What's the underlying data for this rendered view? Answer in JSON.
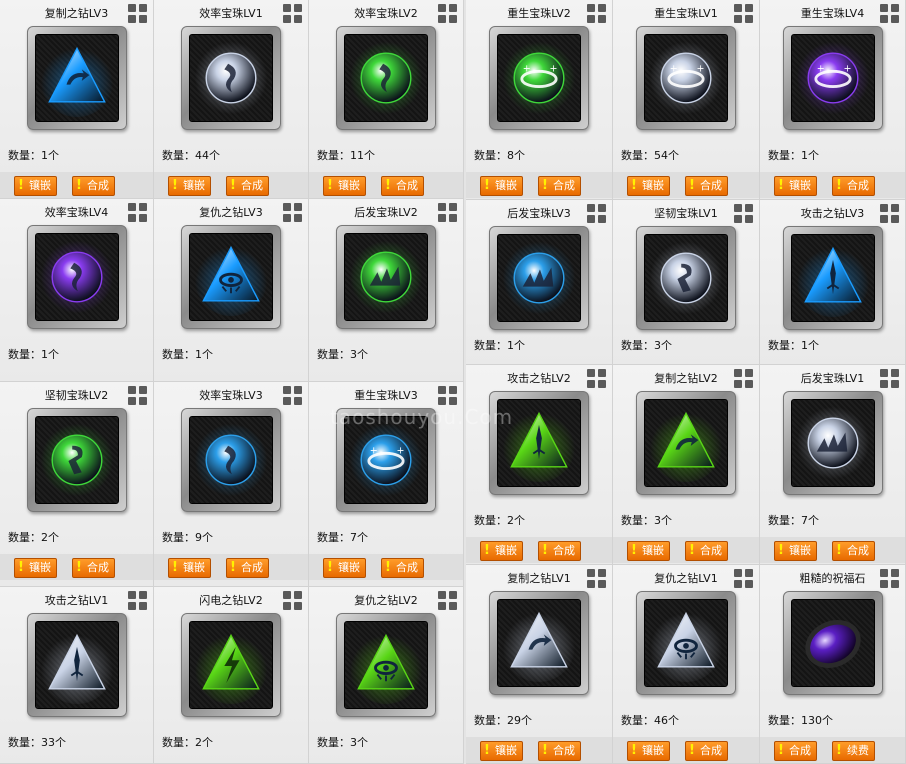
{
  "labels": {
    "quantity_prefix": "数量："
  },
  "left_panel": {
    "cards": [
      {
        "title": "复制之钻LV3",
        "qty": "1个",
        "gem": "pyramid",
        "color": "#1a9cff",
        "glyph": "loop",
        "btn1": "镶嵌",
        "btn2": "合成"
      },
      {
        "title": "效率宝珠LV1",
        "qty": "44个",
        "gem": "orb",
        "color": "#c9d3e6",
        "glyph": "swirl",
        "btn1": "镶嵌",
        "btn2": "合成"
      },
      {
        "title": "效率宝珠LV2",
        "qty": "11个",
        "gem": "orb",
        "color": "#3fd83a",
        "glyph": "swirl",
        "btn1": "镶嵌",
        "btn2": "合成"
      },
      {
        "title": "效率宝珠LV4",
        "qty": "1个",
        "gem": "orb",
        "color": "#8a3cf0",
        "glyph": "swirl",
        "btn1": "",
        "btn2": ""
      },
      {
        "title": "复仇之钻LV3",
        "qty": "1个",
        "gem": "pyramid",
        "color": "#1a9cff",
        "glyph": "eye",
        "btn1": "",
        "btn2": ""
      },
      {
        "title": "后发宝珠LV2",
        "qty": "3个",
        "gem": "orb",
        "color": "#3fd83a",
        "glyph": "spikes",
        "btn1": "",
        "btn2": ""
      },
      {
        "title": "坚韧宝珠LV2",
        "qty": "2个",
        "gem": "orb",
        "color": "#3fd83a",
        "glyph": "hook",
        "btn1": "镶嵌",
        "btn2": "合成"
      },
      {
        "title": "效率宝珠LV3",
        "qty": "9个",
        "gem": "orb",
        "color": "#2c9fea",
        "glyph": "swirl",
        "btn1": "镶嵌",
        "btn2": "合成"
      },
      {
        "title": "重生宝珠LV3",
        "qty": "7个",
        "gem": "orb",
        "color": "#2c9fea",
        "glyph": "ring",
        "btn1": "镶嵌",
        "btn2": "合成"
      },
      {
        "title": "攻击之钻LV1",
        "qty": "33个",
        "gem": "pyramid",
        "color": "#c9d3e6",
        "glyph": "spear",
        "btn1": "",
        "btn2": ""
      },
      {
        "title": "闪电之钻LV2",
        "qty": "2个",
        "gem": "pyramid",
        "color": "#59d616",
        "glyph": "bolt",
        "btn1": "",
        "btn2": ""
      },
      {
        "title": "复仇之钻LV2",
        "qty": "3个",
        "gem": "pyramid",
        "color": "#59d616",
        "glyph": "eye",
        "btn1": "",
        "btn2": ""
      }
    ]
  },
  "right_panel": {
    "cards": [
      {
        "title": "重生宝珠LV2",
        "qty": "8个",
        "gem": "orb",
        "color": "#3fd83a",
        "glyph": "ring",
        "btn1": "镶嵌",
        "btn2": "合成"
      },
      {
        "title": "重生宝珠LV1",
        "qty": "54个",
        "gem": "orb",
        "color": "#c9d3e6",
        "glyph": "ring",
        "btn1": "镶嵌",
        "btn2": "合成"
      },
      {
        "title": "重生宝珠LV4",
        "qty": "1个",
        "gem": "orb",
        "color": "#8a3cf0",
        "glyph": "ring",
        "btn1": "镶嵌",
        "btn2": "合成"
      },
      {
        "title": "后发宝珠LV3",
        "qty": "1个",
        "gem": "orb",
        "color": "#2c9fea",
        "glyph": "spikes",
        "btn1": "",
        "btn2": ""
      },
      {
        "title": "坚韧宝珠LV1",
        "qty": "3个",
        "gem": "orb",
        "color": "#c9d3e6",
        "glyph": "hook",
        "btn1": "",
        "btn2": ""
      },
      {
        "title": "攻击之钻LV3",
        "qty": "1个",
        "gem": "pyramid",
        "color": "#1a9cff",
        "glyph": "spear",
        "btn1": "",
        "btn2": ""
      },
      {
        "title": "攻击之钻LV2",
        "qty": "2个",
        "gem": "pyramid",
        "color": "#59d616",
        "glyph": "spear",
        "btn1": "镶嵌",
        "btn2": "合成"
      },
      {
        "title": "复制之钻LV2",
        "qty": "3个",
        "gem": "pyramid",
        "color": "#59d616",
        "glyph": "loop",
        "btn1": "镶嵌",
        "btn2": "合成"
      },
      {
        "title": "后发宝珠LV1",
        "qty": "7个",
        "gem": "orb",
        "color": "#c9d3e6",
        "glyph": "spikes",
        "btn1": "镶嵌",
        "btn2": "合成"
      },
      {
        "title": "复制之钻LV1",
        "qty": "29个",
        "gem": "pyramid",
        "color": "#c9d3e6",
        "glyph": "loop",
        "btn1": "镶嵌",
        "btn2": "合成"
      },
      {
        "title": "复仇之钻LV1",
        "qty": "46个",
        "gem": "pyramid",
        "color": "#c9d3e6",
        "glyph": "eye",
        "btn1": "镶嵌",
        "btn2": "合成"
      },
      {
        "title": "粗糙的祝福石",
        "qty": "130个",
        "gem": "stone",
        "color": "#5b1fc4",
        "glyph": "none",
        "btn1": "合成",
        "btn2": "续费"
      }
    ]
  },
  "watermark": "taoshouyou.Com"
}
